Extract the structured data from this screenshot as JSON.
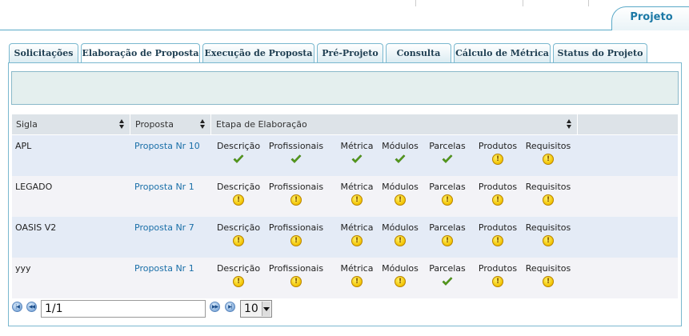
{
  "header": {
    "project_tab": "Projeto"
  },
  "tabs": [
    {
      "label": "Solicitações"
    },
    {
      "label": "Elaboração de Proposta"
    },
    {
      "label": "Execução de Proposta"
    },
    {
      "label": "Pré-Projeto"
    },
    {
      "label": "Consulta"
    },
    {
      "label": "Cálculo de Métrica"
    },
    {
      "label": "Status do Projeto"
    }
  ],
  "active_tab": "Elaboração de Proposta",
  "grid": {
    "columns": [
      "Sigla",
      "Proposta",
      "Etapa de Elaboração"
    ],
    "stages": [
      "Descrição",
      "Profissionais",
      "Métrica",
      "Módulos",
      "Parcelas",
      "Produtos",
      "Requisitos"
    ],
    "rows": [
      {
        "sigla": "APL",
        "proposta": "Proposta Nr 10",
        "status": [
          "check",
          "check",
          "check",
          "check",
          "check",
          "warning",
          "warning"
        ]
      },
      {
        "sigla": "LEGADO",
        "proposta": "Proposta Nr 1",
        "status": [
          "warning",
          "warning",
          "warning",
          "warning",
          "warning",
          "warning",
          "warning"
        ]
      },
      {
        "sigla": "OASIS V2",
        "proposta": "Proposta Nr 7",
        "status": [
          "warning",
          "warning",
          "warning",
          "warning",
          "warning",
          "warning",
          "warning"
        ]
      },
      {
        "sigla": "yyy",
        "proposta": "Proposta Nr 1",
        "status": [
          "warning",
          "warning",
          "warning",
          "warning",
          "check",
          "warning",
          "warning"
        ]
      }
    ]
  },
  "pager": {
    "page": "1/1",
    "page_size": "10"
  },
  "colors": {
    "check": "#5aa01e",
    "warning": "#f2c200",
    "link": "#1a6fa8"
  }
}
